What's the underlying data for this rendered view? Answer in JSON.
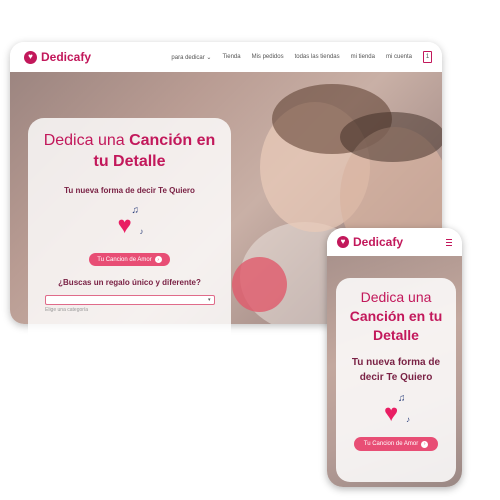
{
  "brand": {
    "name": "Dedicafy",
    "color": "#c2185b",
    "accent": "#e84e75"
  },
  "desktop": {
    "nav": {
      "items": [
        "para dedicar",
        "Tienda",
        "Mis pedidos",
        "todas las tiendas",
        "mi tienda",
        "mi cuenta"
      ],
      "dropdown_icon": "chevron-down-icon",
      "cart_count": "1"
    },
    "hero": {
      "title_regular": "Dedica una ",
      "title_bold": "Canción en tu Detalle",
      "subtitle": "Tu nueva forma de decir Te Quiero",
      "cta_label": "Tu Cancion de Amor",
      "question": "¿Buscas un regalo único y diferente?",
      "select_hint": "Elige una categoría"
    }
  },
  "mobile": {
    "menu_icon": "hamburger-menu-icon",
    "hero": {
      "title_regular": "Dedica una ",
      "title_bold": "Canción en tu Detalle",
      "subtitle": "Tu nueva forma de decir Te Quiero",
      "cta_label": "Tu Cancion de Amor"
    }
  }
}
